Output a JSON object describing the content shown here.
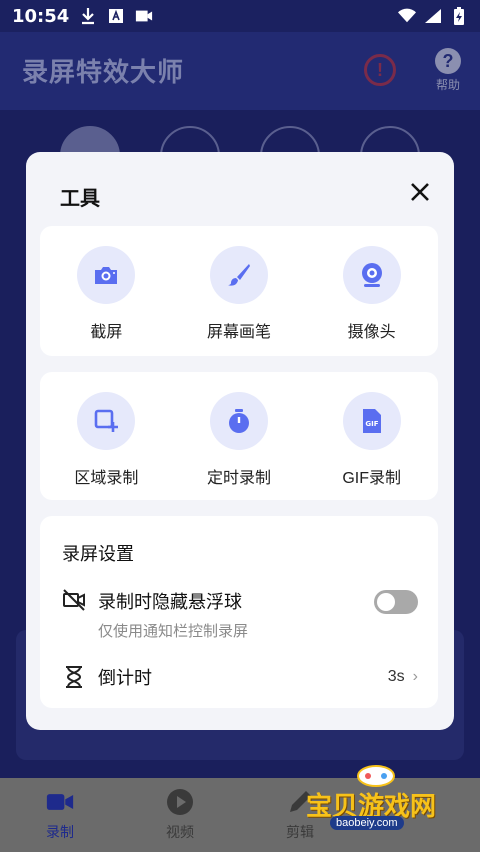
{
  "status_bar": {
    "time": "10:54"
  },
  "app": {
    "title": "录屏特效大师",
    "help_label": "帮助"
  },
  "bottom_nav": [
    {
      "label": "录制"
    },
    {
      "label": "视频"
    },
    {
      "label": "剪辑"
    },
    {
      "label": ""
    }
  ],
  "dialog": {
    "title": "工具",
    "tools_row1": [
      {
        "label": "截屏",
        "icon": "camera-icon"
      },
      {
        "label": "屏幕画笔",
        "icon": "brush-icon"
      },
      {
        "label": "摄像头",
        "icon": "webcam-icon"
      }
    ],
    "tools_row2": [
      {
        "label": "区域录制",
        "icon": "region-record-icon"
      },
      {
        "label": "定时录制",
        "icon": "timer-icon"
      },
      {
        "label": "GIF录制",
        "icon": "gif-icon"
      }
    ],
    "settings": {
      "title": "录屏设置",
      "hide_float": {
        "label": "录制时隐藏悬浮球",
        "sub": "仅使用通知栏控制录屏",
        "enabled": false
      },
      "countdown": {
        "label": "倒计时",
        "value": "3s"
      }
    }
  },
  "watermark": {
    "text": "宝贝游戏网",
    "url": "baobeiy.com"
  },
  "colors": {
    "accent": "#5a6ef0",
    "icon_bg": "#e6e9fb",
    "app_bg": "#1a1f5c"
  }
}
